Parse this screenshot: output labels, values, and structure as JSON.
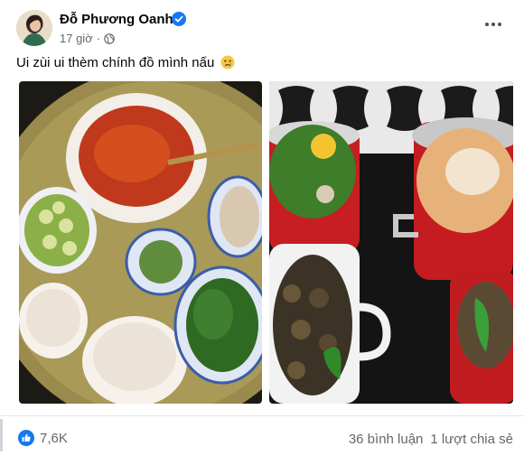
{
  "post": {
    "author": "Đỗ Phương Oanh",
    "time": "17 giờ",
    "dot": "·",
    "caption": "Ui zùi ui thèm chính đồ mình nấu",
    "caption_emoji": "sad-face-emoji"
  },
  "icons": {
    "verified": "verified-badge-icon",
    "audience": "globe-icon",
    "more": "more-options-icon",
    "like": "like-icon"
  },
  "engagement": {
    "reactions_count": "7,6K",
    "comments": "36 bình luận",
    "shares": "1 lượt chia sẻ"
  },
  "colors": {
    "facebook_blue": "#1877f2",
    "muted_text": "#65676b"
  }
}
